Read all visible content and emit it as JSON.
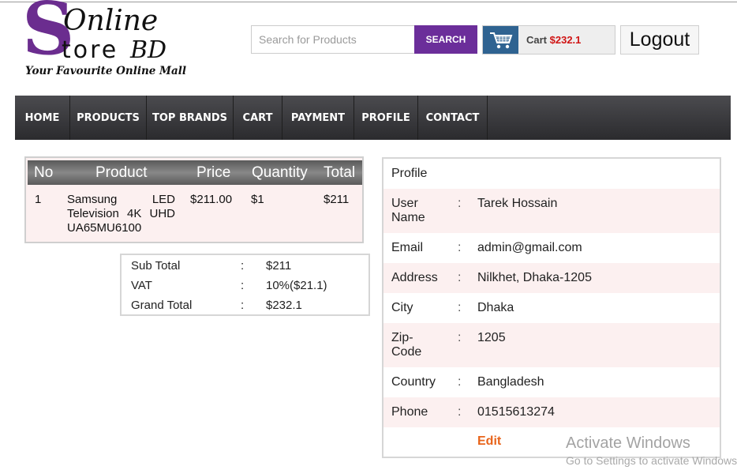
{
  "logo": {
    "s_letter": "S",
    "online": "Online",
    "store": "tore",
    "bd": "BD",
    "tagline": "Your Favourite Online Mall"
  },
  "search": {
    "placeholder": "Search for Products",
    "button_label": "SEARCH"
  },
  "cart": {
    "label": "Cart",
    "amount": "$232.1",
    "icon": "shopping-cart-icon"
  },
  "logout_label": "Logout",
  "nav": {
    "items": [
      {
        "label": "HOME"
      },
      {
        "label": "PRODUCTS"
      },
      {
        "label": "TOP BRANDS"
      },
      {
        "label": "CART"
      },
      {
        "label": "PAYMENT"
      },
      {
        "label": "PROFILE"
      },
      {
        "label": "CONTACT"
      }
    ]
  },
  "cart_table": {
    "headers": {
      "no": "No",
      "product": "Product",
      "price": "Price",
      "quantity": "Quantity",
      "total": "Total"
    },
    "rows": [
      {
        "no": "1",
        "product": "Samsung LED Television 4K UHD UA65MU6100",
        "price": "$211.00",
        "quantity": "$1",
        "total": "$211"
      }
    ]
  },
  "totals": {
    "colon": ":",
    "sub_total": {
      "label": "Sub Total",
      "value": "$211"
    },
    "vat": {
      "label": "VAT",
      "value": "10%($21.1)"
    },
    "grand_total": {
      "label": "Grand Total",
      "value": "$232.1"
    }
  },
  "profile": {
    "title": "Profile",
    "colon": ":",
    "fields": {
      "user_name": {
        "label": "User Name",
        "value": "Tarek Hossain"
      },
      "email": {
        "label": "Email",
        "value": "admin@gmail.com"
      },
      "address": {
        "label": "Address",
        "value": "Nilkhet, Dhaka-1205"
      },
      "city": {
        "label": "City",
        "value": "Dhaka"
      },
      "zip": {
        "label": "Zip-Code",
        "value": "1205"
      },
      "country": {
        "label": "Country",
        "value": "Bangladesh"
      },
      "phone": {
        "label": "Phone",
        "value": "01515613274"
      }
    },
    "edit_label": "Edit"
  },
  "watermark": {
    "title": "Activate Windows",
    "subtitle": "Go to Settings to activate Windows."
  },
  "colors": {
    "brand_purple": "#6b2e9a",
    "cart_blue": "#2f6391",
    "price_red": "#d01515",
    "edit_orange": "#e8641b",
    "row_tint": "#fcf0f0"
  }
}
